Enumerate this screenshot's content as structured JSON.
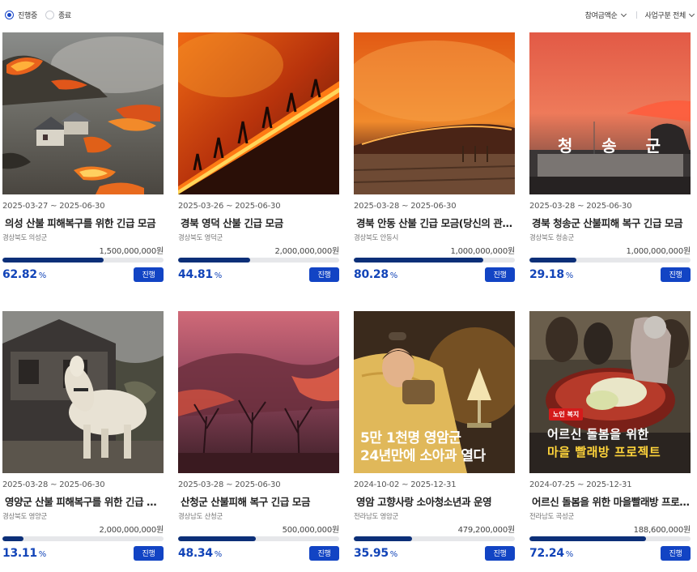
{
  "filters": {
    "status_options": [
      {
        "label": "진행중",
        "selected": true
      },
      {
        "label": "종료",
        "selected": false
      }
    ],
    "sort": {
      "label": "참여금액순"
    },
    "category": {
      "label": "사업구분 전체"
    }
  },
  "colors": {
    "accent": "#1244b8",
    "progress_fill": "#0c2f78",
    "badge_bg": "#1244c4"
  },
  "cards": [
    {
      "date": "2025-03-27 ~ 2025-06-30",
      "title": "의성 산불 피해복구를 위한 긴급 모금",
      "region": "경상북도 의성군",
      "goal": "1,500,000,000원",
      "percent": "62.82",
      "progress": 62.82,
      "unit": "%",
      "status": "진행"
    },
    {
      "date": "2025-03-26 ~ 2025-06-30",
      "title": "경북 영덕 산불 긴급 모금",
      "region": "경상북도 영덕군",
      "goal": "2,000,000,000원",
      "percent": "44.81",
      "progress": 44.81,
      "unit": "%",
      "status": "진행"
    },
    {
      "date": "2025-03-28 ~ 2025-06-30",
      "title": "경북 안동 산불 긴급 모금(당신의 관심이 필요합니다)",
      "region": "경상북도 안동시",
      "goal": "1,000,000,000원",
      "percent": "80.28",
      "progress": 80.28,
      "unit": "%",
      "status": "진행"
    },
    {
      "date": "2025-03-28 ~ 2025-06-30",
      "title": "경북 청송군 산불피해 복구 긴급 모금",
      "region": "경상북도 청송군",
      "goal": "1,000,000,000원",
      "percent": "29.18",
      "progress": 29.18,
      "unit": "%",
      "status": "진행",
      "image_text": [
        "청",
        "송",
        "군"
      ]
    },
    {
      "date": "2025-03-28 ~ 2025-06-30",
      "title": "영양군 산불 피해복구를 위한 긴급 모금",
      "region": "경상북도 영양군",
      "goal": "2,000,000,000원",
      "percent": "13.11",
      "progress": 13.11,
      "unit": "%",
      "status": "진행"
    },
    {
      "date": "2025-03-28 ~ 2025-06-30",
      "title": "산청군 산불피해 복구 긴급 모금",
      "region": "경상남도 산청군",
      "goal": "500,000,000원",
      "percent": "48.34",
      "progress": 48.34,
      "unit": "%",
      "status": "진행"
    },
    {
      "date": "2024-10-02 ~ 2025-12-31",
      "title": "영암 고향사랑 소아청소년과 운영",
      "region": "전라남도 영암군",
      "goal": "479,200,000원",
      "percent": "35.95",
      "progress": 35.95,
      "unit": "%",
      "status": "진행",
      "image_text": [
        "5만 1천명 영암군",
        "24년만에 소아과 열다"
      ]
    },
    {
      "date": "2024-07-25 ~ 2025-12-31",
      "title": "어르신 돌봄을 위한 마을빨래방 프로젝트",
      "region": "전라남도 곡성군",
      "goal": "188,600,000원",
      "percent": "72.24",
      "progress": 72.24,
      "unit": "%",
      "status": "진행",
      "image_text": [
        "노인 복지",
        "어르신 돌봄을 위한",
        "마을 빨래방 프로젝트"
      ]
    }
  ]
}
